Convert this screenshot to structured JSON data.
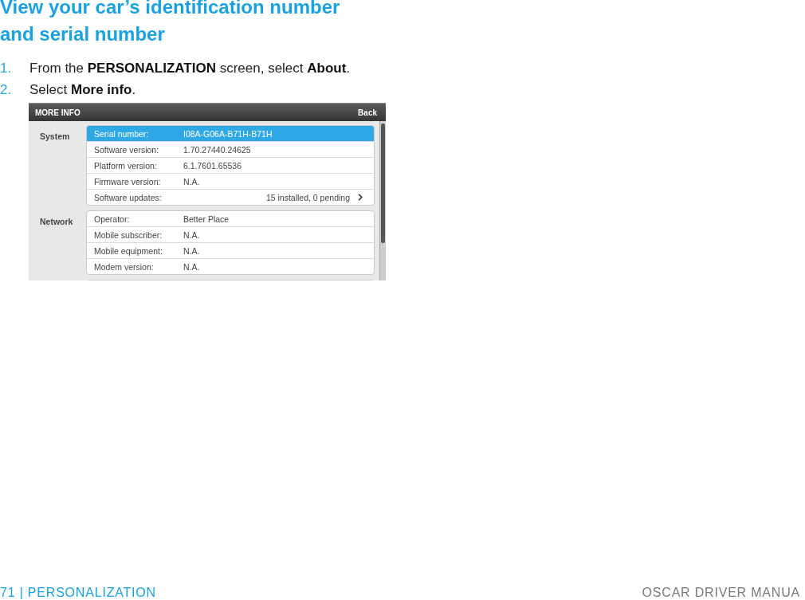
{
  "heading": "View your car’s identification number and serial number",
  "steps": [
    {
      "number": "1.",
      "text": "From the **PERSONALIZATION** screen, select **About**."
    },
    {
      "number": "2.",
      "text": "Select **More info**."
    }
  ],
  "screen": {
    "title": "MORE INFO",
    "back": "Back",
    "sections": [
      {
        "label": "System",
        "rows": [
          {
            "kind": "info",
            "label": "Serial number:",
            "value": "I08A-G06A-B71H-B71H",
            "selected": true
          },
          {
            "kind": "info",
            "label": "Software version:",
            "value": "1.70.27440.24625",
            "selected": false
          },
          {
            "kind": "info",
            "label": "Platform version:",
            "value": "6.1.7601.65536",
            "selected": false
          },
          {
            "kind": "info",
            "label": "Firmware version:",
            "value": "N.A.",
            "selected": false
          },
          {
            "kind": "link",
            "label": "Software updates:",
            "value": "15 installed, 0 pending",
            "selected": false
          }
        ]
      },
      {
        "label": "Network",
        "rows": [
          {
            "kind": "info",
            "label": "Operator:",
            "value": "Better Place",
            "selected": false
          },
          {
            "kind": "info",
            "label": "Mobile subscriber:",
            "value": "N.A.",
            "selected": false
          },
          {
            "kind": "info",
            "label": "Mobile equipment:",
            "value": "N.A.",
            "selected": false
          },
          {
            "kind": "info",
            "label": "Modem version:",
            "value": "N.A.",
            "selected": false
          }
        ]
      }
    ]
  },
  "footer": {
    "section": "71 | PERSONALIZATION",
    "manual": "OSCAR DRIVER MANUA"
  }
}
